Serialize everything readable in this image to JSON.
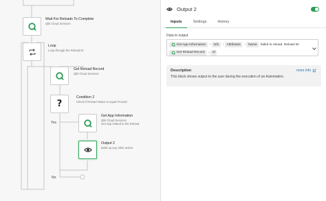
{
  "canvas": {
    "blocks": [
      {
        "title": "Wait For Reloads To Complete",
        "subtitle": "Qlik Cloud Services",
        "icon": "qlik-icon"
      },
      {
        "title": "Loop",
        "subtitle": "Loop through the Reload ID",
        "icon": "loop-icon"
      },
      {
        "title": "Get Reload Record",
        "subtitle": "Qlik Cloud Services",
        "icon": "qlik-icon"
      },
      {
        "title": "Condition 2",
        "subtitle": "Check if Reload Status is equal FAILED",
        "icon": "question-icon"
      },
      {
        "title": "Get App Information",
        "subtitle": "Qlik Cloud Services",
        "subtitle2": "Get App related to the Reload",
        "icon": "qlik-icon"
      },
      {
        "title": "Output 2",
        "subtitle": "Build up any other action",
        "icon": "eye-icon"
      }
    ],
    "branches": {
      "yes": "Yes",
      "no": "No"
    }
  },
  "panel": {
    "title": "Output 2",
    "icon": "eye-icon",
    "enabled": true,
    "tabs": [
      {
        "label": "Inputs",
        "active": true
      },
      {
        "label": "Settings",
        "active": false
      },
      {
        "label": "History",
        "active": false
      }
    ],
    "data_label": "Data to output",
    "data_row1": {
      "chip1": "Get App Information",
      "chip2": "Info",
      "chip3": "Attributes",
      "chip4": "Name",
      "text": "failed to reload. Reload ID:"
    },
    "data_row2": {
      "chip1": "Get Reload Record",
      "chip2": "Id"
    },
    "description": {
      "title": "Description",
      "text": "This block shows output to the user during the execution of an Automation.",
      "more": "more info"
    }
  },
  "colors": {
    "accent": "#2d9c56",
    "link": "#1f6fb2",
    "canvas_bg": "#f7f7f7"
  }
}
